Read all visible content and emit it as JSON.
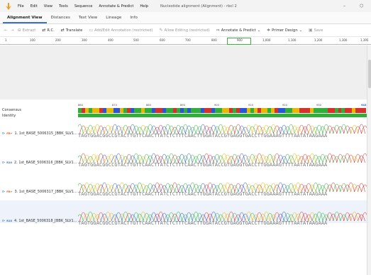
{
  "menubar": {
    "items": [
      "File",
      "Edit",
      "View",
      "Tools",
      "Sequence",
      "Annotate & Predict",
      "Help"
    ],
    "window_title": "Nucleotide alignment (Alignment) - rbcl 2",
    "minimize": "–",
    "close": "⬡"
  },
  "tabs": [
    "Alignment View",
    "Distances",
    "Text View",
    "Lineage",
    "Info"
  ],
  "toolbar": {
    "back": "←",
    "forward": "→",
    "extract": "Extract",
    "rc": "R.C.",
    "translate": "Translate",
    "add_edit_annotation": "Add/Edit Annotation (restricted)",
    "allow_editing": "Allow Editing (restricted)",
    "annotate_predict": "Annotate & Predict",
    "primer_design": "Primer Design",
    "save": "Save"
  },
  "ruler": {
    "labels": [
      "1",
      "100",
      "200",
      "300",
      "400",
      "500",
      "600",
      "700",
      "800",
      "900",
      "1,000",
      "1,100",
      "1,200",
      "1,300",
      "1,395"
    ]
  },
  "axis": {
    "labels": [
      "860",
      "870",
      "880",
      "890",
      "900",
      "910",
      "920",
      "930",
      "943"
    ]
  },
  "labels": {
    "consensus": "Consensus",
    "identity": "Identity"
  },
  "sequences": [
    {
      "name": "1. 1st_BASE_5006315_[BBK_SLV1...",
      "chip": "FR+",
      "chip_color": "#e05a1a",
      "seq": "TAGTGGACGGCCGTACTTGTTCAACTTATCTCTTTCAACTTGGATACCGTGAGGTGACCTTGGAAAGTTTTAATATAAGAAA"
    },
    {
      "name": "2. 1st_BASE_5006316_[BBK_SLV1...",
      "chip": "R10",
      "chip_color": "#3a6fd0",
      "seq": "TAGTGGACGGCCGTACTTGTTCAACTTATCTCTTTCAACTTGGATACCGTGAGGTGACCTTGGAAAGTTTTAATATAAGAAA"
    },
    {
      "name": "3. 1st_BASE_5006317_[BBK_SLV1...",
      "chip": "FR+",
      "chip_color": "#e05a1a",
      "seq": "TAGTGGACGGCCGTACTTGTTCAACTTATCTCTTTCAACTTGGATACCGTGAGGTGACCTTGGAAAGTTTTAATATAAGAAA"
    },
    {
      "name": "4. 1st_BASE_5006318_[BBK_SLV1...",
      "chip": "R10",
      "chip_color": "#3a6fd0",
      "seq": "TAGTGGACGGCCGTACTTGTTCAACTTATCTCTTTCAACTTGGATACCGTGAGGTGACCTTGGAAAGTTTTAATATAAGAAA"
    }
  ],
  "colors": {
    "A": "#d8312b",
    "C": "#2b55d8",
    "G": "#e6b800",
    "T": "#2fae3a",
    "identity": "#2fae3a",
    "selected_row": "#eef3fb"
  },
  "consensus_seq": "TAGTGGACGGCCGTACTTGTTCAACTTATCTCTTTCAACTTGGATACCGTGAGGTGACCTTGGAAAGTTTTAATATAAGAAA"
}
